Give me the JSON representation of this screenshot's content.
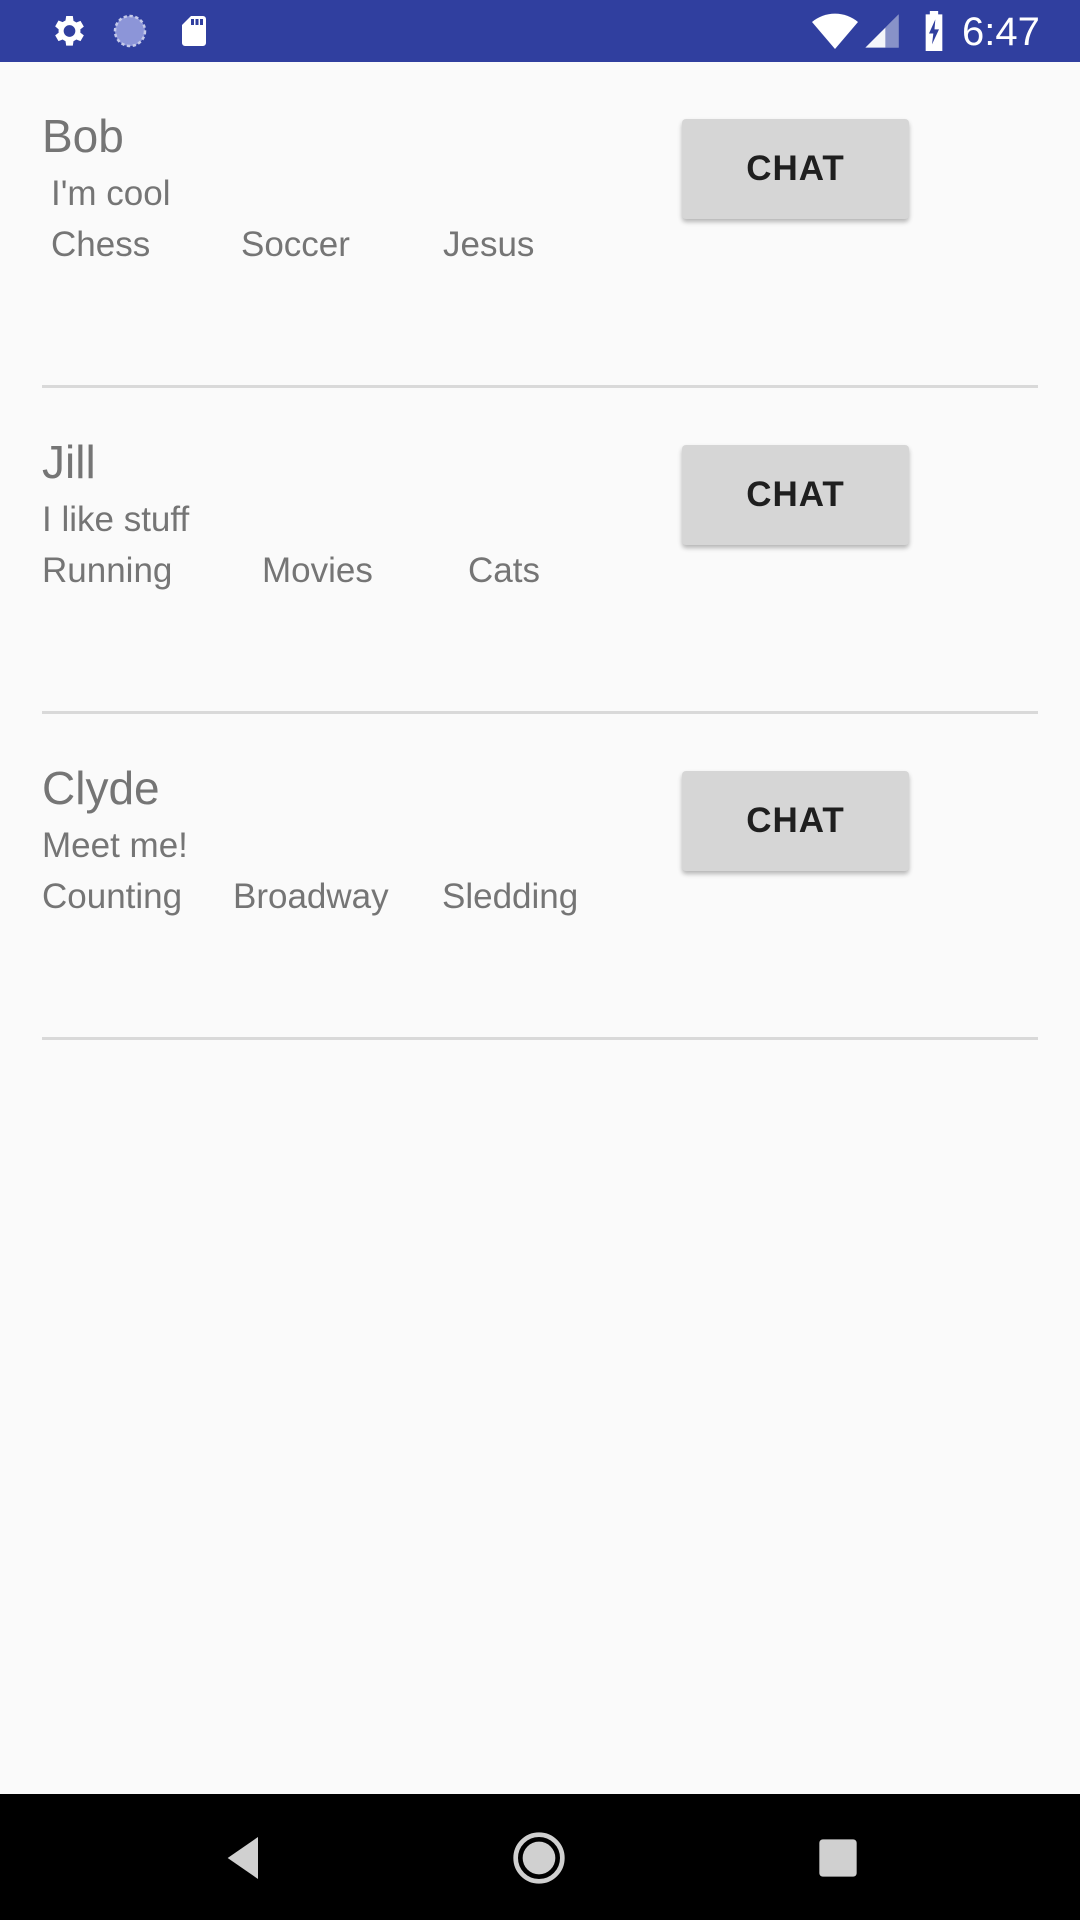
{
  "status_bar": {
    "time": "6:47",
    "icons": {
      "left": [
        "gear-icon",
        "sync-icon",
        "sd-card-icon"
      ],
      "right": [
        "wifi-icon",
        "signal-icon",
        "battery-charging-icon"
      ]
    },
    "color": "#303f9f"
  },
  "profiles": [
    {
      "name": "Bob",
      "bio": "I'm cool",
      "interests": [
        "Chess",
        "Soccer",
        "Jesus"
      ],
      "chat_label": "CHAT"
    },
    {
      "name": "Jill",
      "bio": "I like stuff",
      "interests": [
        "Running",
        "Movies",
        "Cats"
      ],
      "chat_label": "CHAT"
    },
    {
      "name": "Clyde",
      "bio": "Meet me!",
      "interests": [
        "Counting",
        "Broadway",
        "Sledding"
      ],
      "chat_label": "CHAT"
    }
  ],
  "nav_bar": {
    "icons": [
      "back-icon",
      "home-icon",
      "recents-icon"
    ]
  }
}
